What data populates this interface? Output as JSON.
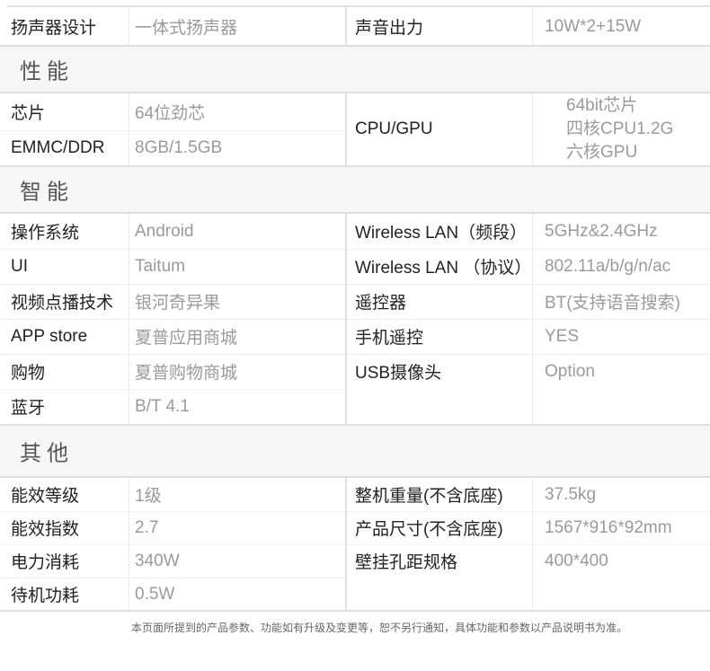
{
  "row_top": [
    {
      "label": "扬声器设计",
      "value": "一体式扬声器"
    },
    {
      "label": "声音出力",
      "value": "10W*2+15W"
    }
  ],
  "sections": {
    "performance": {
      "title": "性能",
      "left": [
        {
          "label": "芯片",
          "value": "64位劲芯"
        },
        {
          "label": "EMMC/DDR",
          "value": "8GB/1.5GB"
        }
      ],
      "right": {
        "label": "CPU/GPU",
        "values": [
          "64bit芯片",
          "四核CPU1.2G",
          "六核GPU"
        ]
      }
    },
    "smart": {
      "title": "智能",
      "left": [
        {
          "label": "操作系统",
          "value": "Android"
        },
        {
          "label": "UI",
          "value": "Taitum"
        },
        {
          "label": "视频点播技术",
          "value": "银河奇异果"
        },
        {
          "label": "APP store",
          "value": "夏普应用商城"
        },
        {
          "label": "购物",
          "value": "夏普购物商城"
        },
        {
          "label": "蓝牙",
          "value": "B/T 4.1"
        }
      ],
      "right": [
        {
          "label": "Wireless LAN（频段）",
          "value": "5GHz&2.4GHz"
        },
        {
          "label": "Wireless LAN （协议）",
          "value": "802.11a/b/g/n/ac"
        },
        {
          "label": "遥控器",
          "value": "BT(支持语音搜索)"
        },
        {
          "label": "手机遥控",
          "value": "YES"
        },
        {
          "label": "USB摄像头",
          "value": "Option"
        }
      ]
    },
    "other": {
      "title": "其他",
      "left": [
        {
          "label": "能效等级",
          "value": "1级"
        },
        {
          "label": "能效指数",
          "value": "2.7"
        },
        {
          "label": "电力消耗",
          "value": "340W"
        },
        {
          "label": "待机功耗",
          "value": "0.5W"
        }
      ],
      "right": [
        {
          "label": "整机重量(不含底座)",
          "value": "37.5kg"
        },
        {
          "label": "产品尺寸(不含底座)",
          "value": "1567*916*92mm"
        },
        {
          "label": "壁挂孔距规格",
          "value": "400*400"
        }
      ]
    }
  },
  "footnote": "本页面所提到的产品参数、功能如有升级及变更等，恕不另行通知，具体功能和参数以产品说明书为准。"
}
